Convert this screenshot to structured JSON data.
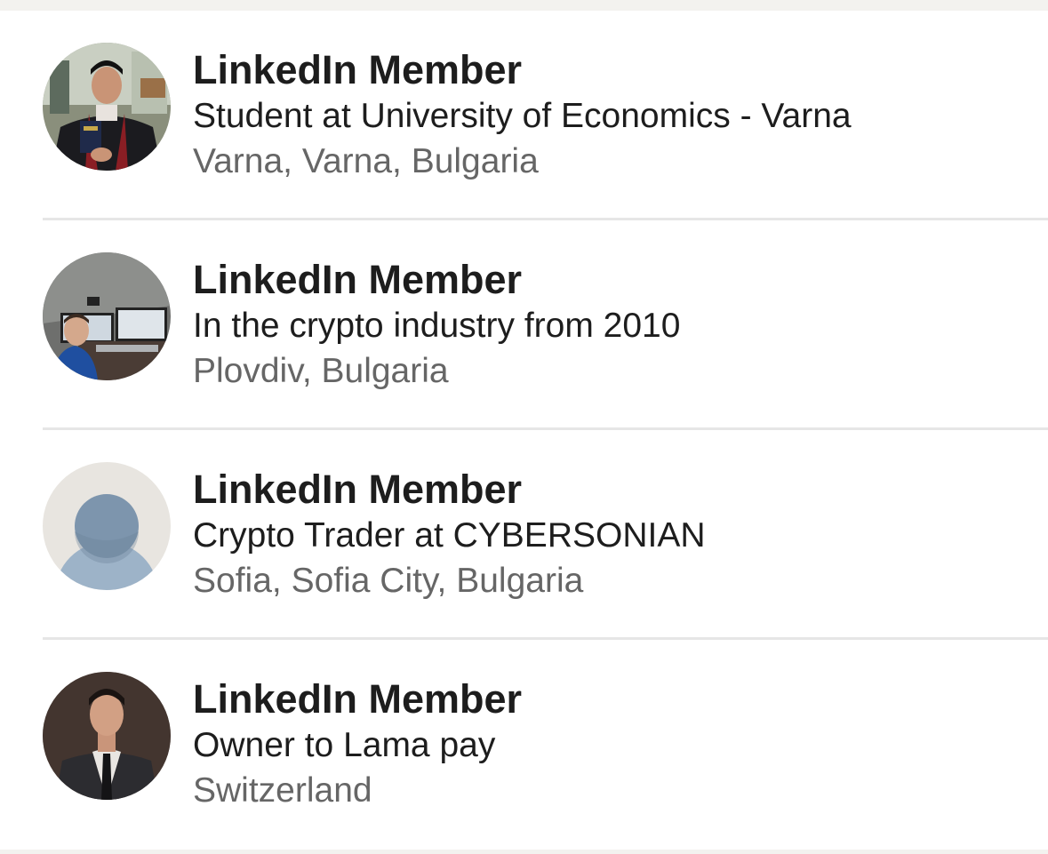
{
  "results": [
    {
      "name": "LinkedIn Member",
      "headline": "Student at University of Economics - Varna",
      "location": "Varna, Varna, Bulgaria",
      "avatar": "graduate-photo"
    },
    {
      "name": "LinkedIn Member",
      "headline": "In the crypto industry from 2010",
      "location": "Plovdiv, Bulgaria",
      "avatar": "desk-monitors-photo"
    },
    {
      "name": "LinkedIn Member",
      "headline": "Crypto Trader at CYBERSONIAN",
      "location": "Sofia, Sofia City, Bulgaria",
      "avatar": "default-person-icon"
    },
    {
      "name": "LinkedIn Member",
      "headline": "Owner to Lama pay",
      "location": "Switzerland",
      "avatar": "suit-portrait-photo"
    }
  ],
  "colors": {
    "page_background": "#f3f2ef",
    "primary_text": "#1d1d1d",
    "secondary_text": "#666666",
    "divider": "#e6e6e6",
    "placeholder_background": "#e8e5e0",
    "placeholder_figure": "#9db3c8",
    "placeholder_head": "#7d95ad"
  }
}
